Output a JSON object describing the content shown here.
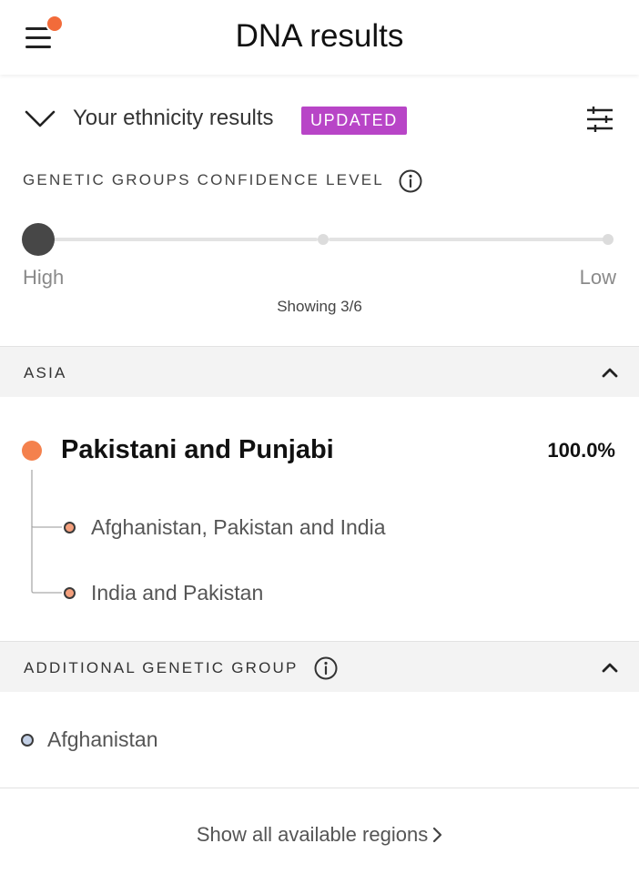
{
  "header": {
    "title": "DNA results",
    "notification_color": "#f26b3a"
  },
  "ethnicity": {
    "label": "Your ethnicity results",
    "badge": "UPDATED",
    "badge_color": "#b845c7"
  },
  "confidence": {
    "label": "GENETIC GROUPS CONFIDENCE LEVEL",
    "high_label": "High",
    "low_label": "Low",
    "showing_text": "Showing 3/6",
    "slider_steps": 3,
    "slider_selected_step": 0
  },
  "asia_section": {
    "label": "ASIA",
    "region": {
      "name": "Pakistani and Punjabi",
      "percent": "100.0%",
      "color": "#f4814d",
      "subregions": [
        {
          "label": "Afghanistan, Pakistan and India"
        },
        {
          "label": "India and Pakistan"
        }
      ]
    }
  },
  "additional_section": {
    "label": "ADDITIONAL GENETIC GROUP",
    "items": [
      {
        "label": "Afghanistan",
        "color": "#c3d0e6"
      }
    ]
  },
  "footer": {
    "show_all_label": "Show all available regions"
  },
  "icons": {
    "menu": "hamburger-icon",
    "collapse": "chevron-down-icon",
    "filter": "sliders-icon",
    "info": "info-icon",
    "section_toggle": "caret-up-icon",
    "show_all": "chevron-right-icon"
  }
}
